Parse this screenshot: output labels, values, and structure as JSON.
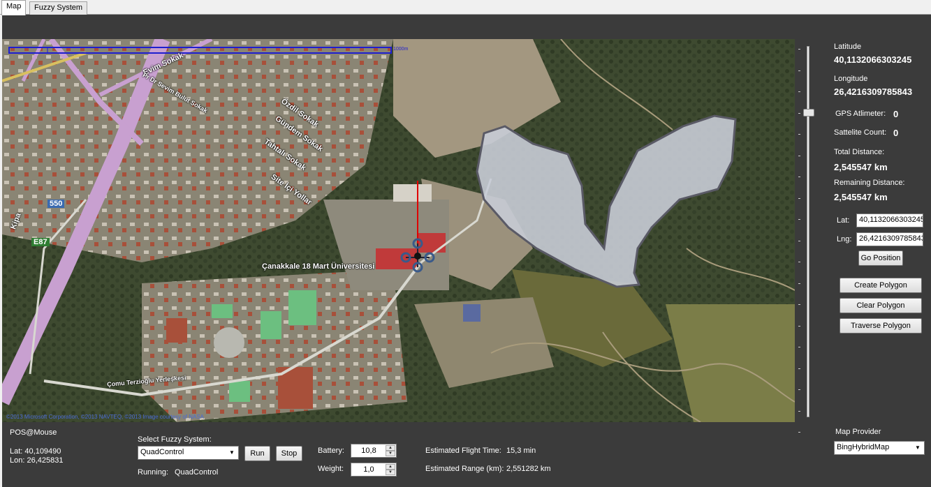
{
  "tabs": [
    {
      "label": "Map",
      "active": true
    },
    {
      "label": "Fuzzy System",
      "active": false
    }
  ],
  "map": {
    "copyright": "©2013 Microsoft Corporation, ©2013 NAVTEQ, ©2013 Image courtesy of NASA",
    "scale_label": "1000m",
    "scale_label_small": "",
    "street_labels": [
      "Evim Sokak",
      "Pr Dr Sevim Bulut Sokak",
      "Özdil Sokak",
      "Gündem Sokak",
      "Tahtalı Sokak",
      "Site İçi Yollar",
      "Çomu Terzioğlu Yerleşkesi",
      "Çanakkale 18 Mart Üniversitesi",
      "Kipa",
      "550",
      "E87"
    ],
    "colors": {
      "polygon_fill": "#c8ccd6",
      "polygon_stroke": "#5a5a66",
      "route": "#e00000",
      "scale_bar": "#1e1ed0"
    }
  },
  "info": {
    "latitude_label": "Latitude",
    "latitude_value": "40,1132066303245",
    "longitude_label": "Longitude",
    "longitude_value": "26,4216309785843",
    "gps_altimeter_label": "GPS Atlimeter:",
    "gps_altimeter_value": "0",
    "satellite_count_label": "Sattelite Count:",
    "satellite_count_value": "0",
    "total_distance_label": "Total Distance:",
    "total_distance_value": "2,545547 km",
    "remaining_distance_label": "Remaining Distance:",
    "remaining_distance_value": "2,545547 km"
  },
  "goto": {
    "lat_label": "Lat:",
    "lat_value": "40,1132066303245",
    "lng_label": "Lng:",
    "lng_value": "26,4216309785843",
    "go_button": "Go Position"
  },
  "polygon_buttons": {
    "create": "Create Polygon",
    "clear": "Clear Polygon",
    "traverse": "Traverse Polygon"
  },
  "bottom": {
    "pos_title": "POS@Mouse",
    "pos_lat": "Lat: 40,109490",
    "pos_lon": "Lon: 26,425831",
    "select_label": "Select Fuzzy System:",
    "fuzzy_selected": "QuadControl",
    "run_button": "Run",
    "stop_button": "Stop",
    "running_label": "Running:",
    "running_value": "QuadControl",
    "battery_label": "Battery:",
    "battery_value": "10,8",
    "weight_label": "Weight:",
    "weight_value": "1,0",
    "flight_time_label": "Estimated Flight Time:",
    "flight_time_value": "15,3 min",
    "range_label": "Estimated Range (km):",
    "range_value": "2,551282 km",
    "provider_label": "Map Provider",
    "provider_selected": "BingHybridMap"
  }
}
